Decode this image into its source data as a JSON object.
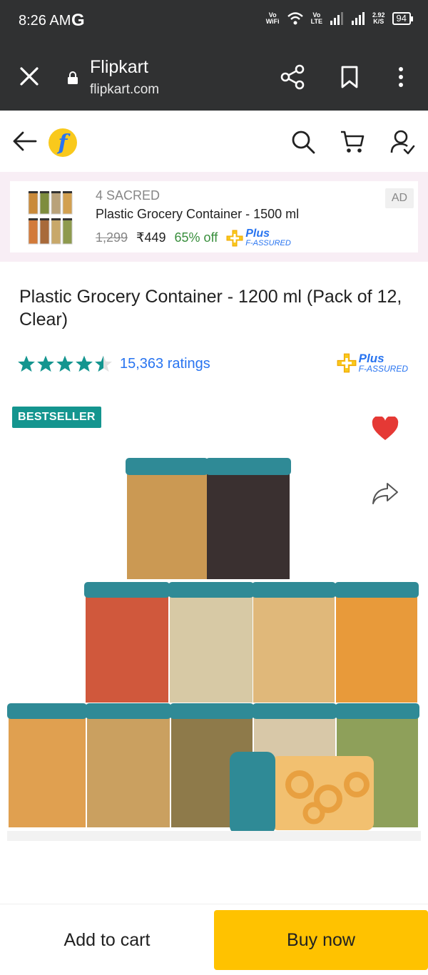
{
  "status_bar": {
    "time": "8:26 AM",
    "google_glyph": "G",
    "vowifi": [
      "Vo",
      "WiFi"
    ],
    "volte": [
      "Vo",
      "LTE"
    ],
    "speed": [
      "2.92",
      "K/S"
    ],
    "battery": "94"
  },
  "browser": {
    "site_name": "Flipkart",
    "url": "flipkart.com"
  },
  "app_header": {
    "logo_glyph": "f"
  },
  "ad": {
    "brand": "4 SACRED",
    "title": "Plastic Grocery Container - 1500 ml",
    "original_price": "1,299",
    "price": "₹449",
    "discount": "65% off",
    "plus_label": "Plus",
    "assured_label": "F-ASSURED",
    "badge": "AD"
  },
  "product": {
    "title": "Plastic Grocery Container  - 1200 ml (Pack of 12, Clear)",
    "rating_value": 4.5,
    "ratings_count": "15,363 ratings",
    "plus_label": "Plus",
    "assured_label": "F-ASSURED",
    "badge": "BESTSELLER",
    "wishlisted": true
  },
  "actions": {
    "add_to_cart": "Add to cart",
    "buy_now": "Buy now"
  },
  "colors": {
    "status_bg": "#303132",
    "flipkart_blue": "#2874f0",
    "flipkart_yellow": "#f9c91c",
    "discount_green": "#388e3c",
    "star_green": "#14958f",
    "buy_now_yellow": "#ffc200",
    "heart_red": "#e53935"
  }
}
